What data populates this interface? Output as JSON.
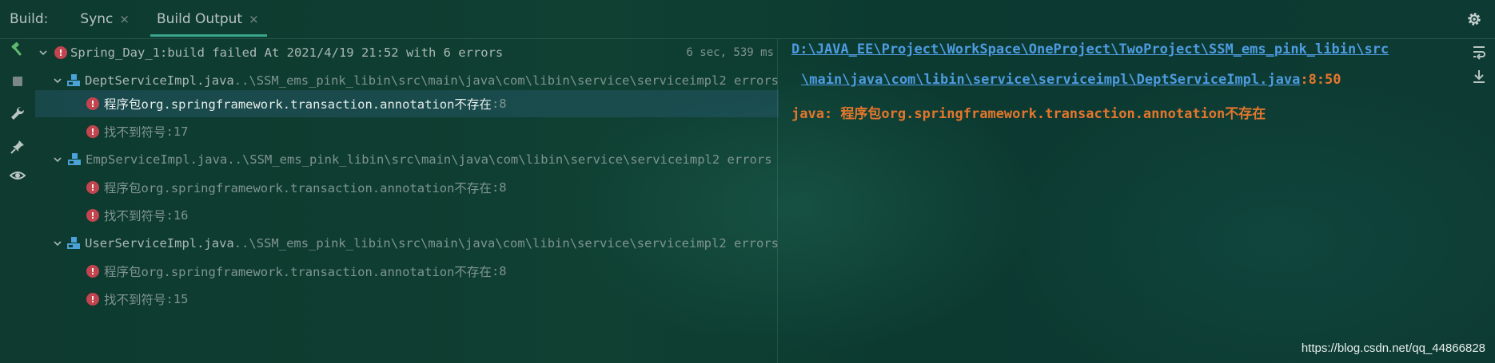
{
  "header": {
    "build_label": "Build:",
    "tabs": [
      {
        "label": "Sync",
        "close": "×"
      },
      {
        "label": "Build Output",
        "close": "×"
      }
    ]
  },
  "tree": {
    "root": {
      "label": "Spring_Day_1:",
      "status": " build failed At 2021/4/19 21:52 with 6 errors",
      "time": "6 sec, 539 ms"
    },
    "files": [
      {
        "name": "DeptServiceImpl.java",
        "path": " ..\\SSM_ems_pink_libin\\src\\main\\java\\com\\libin\\service\\serviceimpl",
        "count": " 2 errors",
        "errors": [
          {
            "message": "程序包org.springframework.transaction.annotation不存在",
            "line": " :8"
          },
          {
            "message": "找不到符号",
            "line": " :17"
          }
        ]
      },
      {
        "name": "EmpServiceImpl.java",
        "path": " ..\\SSM_ems_pink_libin\\src\\main\\java\\com\\libin\\service\\serviceimpl",
        "count": " 2 errors",
        "errors": [
          {
            "message": "程序包org.springframework.transaction.annotation不存在",
            "line": " :8"
          },
          {
            "message": "找不到符号",
            "line": " :16"
          }
        ]
      },
      {
        "name": "UserServiceImpl.java",
        "path": " ..\\SSM_ems_pink_libin\\src\\main\\java\\com\\libin\\service\\serviceimpl",
        "count": " 2 errors",
        "errors": [
          {
            "message": "程序包org.springframework.transaction.annotation不存在",
            "line": " :8"
          },
          {
            "message": "找不到符号",
            "line": " :15"
          }
        ]
      }
    ]
  },
  "detail": {
    "path_line1": "D:\\JAVA_EE\\Project\\WorkSpace\\OneProject\\TwoProject\\SSM_ems_pink_libin\\src",
    "path_line2": "\\main\\java\\com\\libin\\service\\serviceimpl\\DeptServiceImpl.java",
    "position": ":8:50",
    "message": "java: 程序包org.springframework.transaction.annotation不存在"
  },
  "watermark": "https://blog.csdn.net/qq_44866828",
  "colors": {
    "background": "#0f3b30",
    "accent_tab": "#3aa58c",
    "error": "#c2444e",
    "link": "#4d9be0",
    "message": "#e3762c"
  },
  "icons": {
    "tabs_close": "close-icon",
    "settings": "gear-icon",
    "build": "hammer-icon",
    "stop": "stop-icon",
    "wrench": "wrench-icon",
    "pin": "pin-icon",
    "eye": "eye-icon",
    "soft_wrap": "soft-wrap-icon",
    "scroll_end": "scroll-to-end-icon"
  }
}
